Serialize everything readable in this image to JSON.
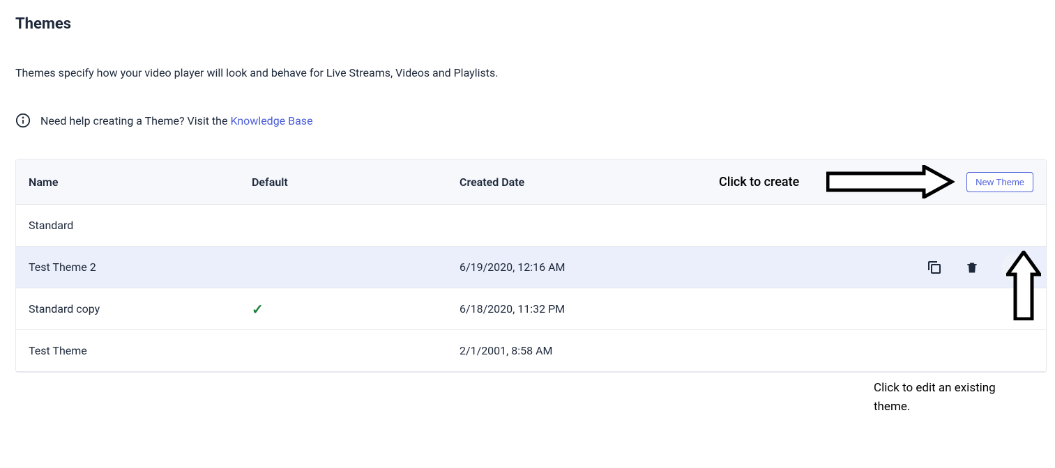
{
  "page": {
    "title": "Themes",
    "description": "Themes specify how your video player will look and behave for Live Streams, Videos and Playlists.",
    "help_prefix": "Need help creating a Theme? Visit the ",
    "help_link": "Knowledge Base"
  },
  "table": {
    "headers": {
      "name": "Name",
      "default": "Default",
      "created": "Created Date"
    },
    "new_button": "New Theme",
    "rows": [
      {
        "name": "Standard",
        "default": false,
        "created": ""
      },
      {
        "name": "Test Theme 2",
        "default": false,
        "created": "6/19/2020, 12:16 AM",
        "selected": true
      },
      {
        "name": "Standard copy",
        "default": true,
        "created": "6/18/2020, 11:32 PM"
      },
      {
        "name": "Test Theme",
        "default": false,
        "created": "2/1/2001, 8:58 AM"
      }
    ]
  },
  "annotations": {
    "create": "Click to create",
    "edit": "Click to edit an existing theme."
  }
}
